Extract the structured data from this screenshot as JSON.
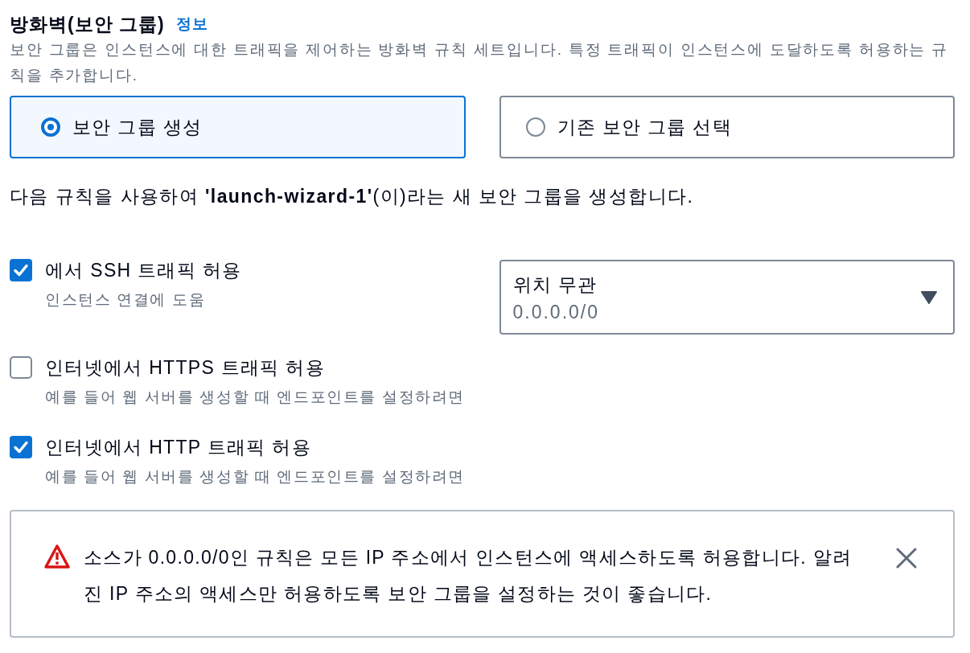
{
  "section": {
    "title": "방화벽(보안 그룹)",
    "info_link": "정보",
    "description": "보안 그룹은 인스턴스에 대한 트래픽을 제어하는 방화벽 규칙 세트입니다. 특정 트래픽이 인스턴스에 도달하도록 허용하는 규칙을 추가합니다."
  },
  "options": [
    {
      "label": "보안 그룹 생성",
      "selected": true
    },
    {
      "label": "기존 보안 그룹 선택",
      "selected": false
    }
  ],
  "summary": "다음 규칙을 사용하여 **'launch-wizard-1'**(이)라는 새 보안 그룹을 생성합니다.",
  "rules": [
    {
      "label": "에서 SSH 트래픽 허용",
      "hint": "인스턴스 연결에 도움",
      "checked": true,
      "source": {
        "value": "위치 무관",
        "detail": "0.0.0.0/0"
      }
    },
    {
      "label": "인터넷에서 HTTPS 트래픽 허용",
      "hint": "예를 들어 웹 서버를 생성할 때 엔드포인트를 설정하려면",
      "checked": false
    },
    {
      "label": "인터넷에서 HTTP 트래픽 허용",
      "hint": "예를 들어 웹 서버를 생성할 때 엔드포인트를 설정하려면",
      "checked": true
    }
  ],
  "alert": {
    "kind": "warning",
    "message": "소스가 0.0.0.0/0인 규칙은 모든 IP 주소에서 인스턴스에 액세스하도록 허용합니다. 알려진 IP 주소의 액세스만 허용하도록 보안 그룹을 설정하는 것이 좋습니다."
  }
}
